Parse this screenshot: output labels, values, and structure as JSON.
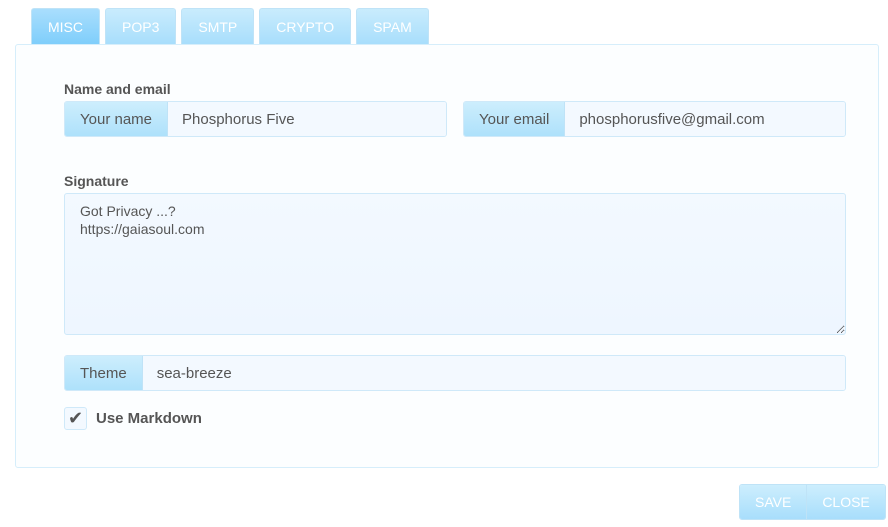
{
  "tabs": [
    {
      "label": "MISC",
      "active": true
    },
    {
      "label": "POP3",
      "active": false
    },
    {
      "label": "SMTP",
      "active": false
    },
    {
      "label": "CRYPTO",
      "active": false
    },
    {
      "label": "SPAM",
      "active": false
    }
  ],
  "name_email": {
    "section_label": "Name and email",
    "name_addon": "Your name",
    "name_value": "Phosphorus Five",
    "email_addon": "Your email",
    "email_value": "phosphorusfive@gmail.com"
  },
  "signature": {
    "section_label": "Signature",
    "value": "Got Privacy ...?\nhttps://gaiasoul.com"
  },
  "theme": {
    "addon": "Theme",
    "value": "sea-breeze"
  },
  "markdown": {
    "checked": true,
    "check_glyph": "✔",
    "label": "Use Markdown"
  },
  "buttons": {
    "save": "SAVE",
    "close": "CLOSE"
  },
  "colors": {
    "accent": "#a8defc",
    "accent_active": "#7fcefb",
    "border": "#cfe9f9",
    "field_bg": "#f3f9ff"
  }
}
